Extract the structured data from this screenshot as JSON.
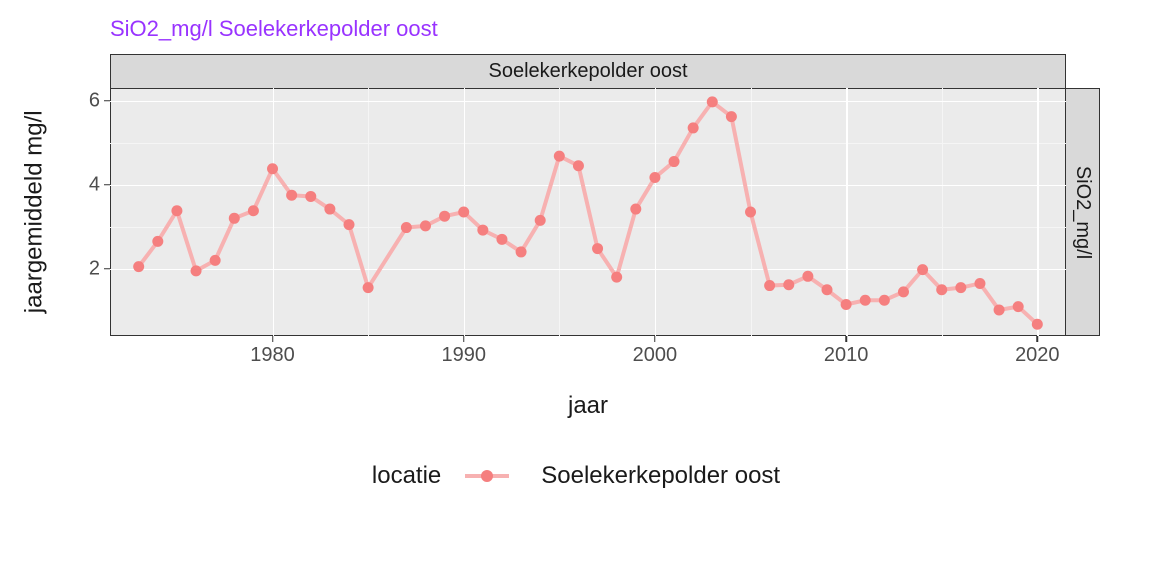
{
  "title": "SiO2_mg/l Soelekerkepolder oost",
  "facet_top": "Soelekerkepolder oost",
  "facet_right": "SiO2_mg/l",
  "xlabel": "jaar",
  "ylabel": "jaargemiddeld\nmg/l",
  "legend_title": "locatie",
  "legend_item": "Soelekerkepolder oost",
  "y_ticks": [
    2,
    4,
    6
  ],
  "x_ticks": [
    1980,
    1990,
    2000,
    2010,
    2020
  ],
  "colors": {
    "title": "#9933ff",
    "line": "#f7b1b1",
    "point": "#f57f7f",
    "panel_bg": "#ebebeb",
    "strip_bg": "#d9d9d9"
  },
  "chart_data": {
    "type": "line",
    "xlabel": "jaar",
    "ylabel": "jaargemiddeld mg/l",
    "xlim": [
      1971.5,
      2021.5
    ],
    "ylim": [
      0.4,
      6.3
    ],
    "series": [
      {
        "name": "Soelekerkepolder oost",
        "x": [
          1973,
          1974,
          1975,
          1976,
          1977,
          1978,
          1979,
          1980,
          1981,
          1982,
          1983,
          1984,
          1985,
          1987,
          1988,
          1989,
          1990,
          1991,
          1992,
          1993,
          1994,
          1995,
          1996,
          1997,
          1998,
          1999,
          2000,
          2001,
          2002,
          2003,
          2004,
          2005,
          2006,
          2007,
          2008,
          2009,
          2010,
          2011,
          2012,
          2013,
          2014,
          2015,
          2016,
          2017,
          2018,
          2019,
          2020
        ],
        "values": [
          2.05,
          2.65,
          3.38,
          1.95,
          2.2,
          3.2,
          3.38,
          4.38,
          3.75,
          3.72,
          3.42,
          3.05,
          1.55,
          2.98,
          3.02,
          3.25,
          3.35,
          2.92,
          2.7,
          2.4,
          3.15,
          4.68,
          4.45,
          2.48,
          1.8,
          3.42,
          4.17,
          4.55,
          5.35,
          5.97,
          5.62,
          3.35,
          1.6,
          1.62,
          1.82,
          1.5,
          1.15,
          1.25,
          1.25,
          1.45,
          1.98,
          1.5,
          1.55,
          1.65,
          1.02,
          1.1,
          0.68
        ]
      }
    ],
    "note_missing_x": [
      1986
    ]
  }
}
